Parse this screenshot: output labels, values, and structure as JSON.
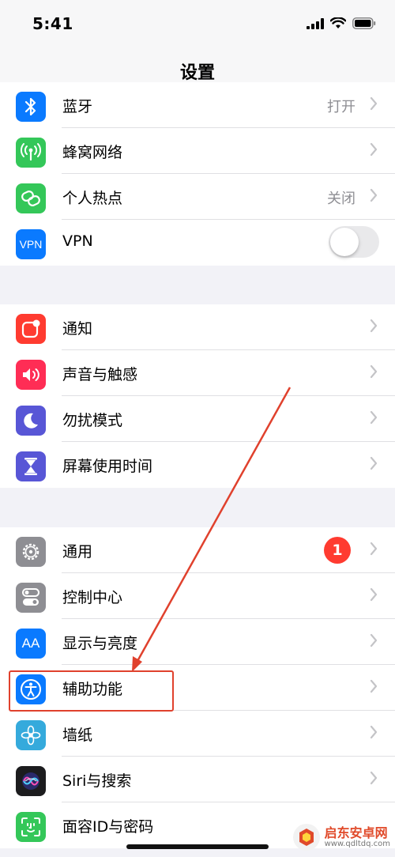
{
  "status": {
    "time": "5:41"
  },
  "nav": {
    "title": "设置"
  },
  "group1": [
    {
      "label": "蓝牙",
      "value": "打开",
      "icon": "bluetooth-icon",
      "color": "#0a7aff"
    },
    {
      "label": "蜂窝网络",
      "icon": "cellular-icon",
      "color": "#34c759"
    },
    {
      "label": "个人热点",
      "value": "关闭",
      "icon": "hotspot-icon",
      "color": "#34c759"
    },
    {
      "label": "VPN",
      "icon_text": "VPN",
      "icon": "vpn-icon",
      "color": "#0a7aff",
      "toggle": false
    }
  ],
  "group2": [
    {
      "label": "通知",
      "icon": "notifications-icon",
      "color": "#ff3b30"
    },
    {
      "label": "声音与触感",
      "icon": "sound-icon",
      "color": "#ff2d55"
    },
    {
      "label": "勿扰模式",
      "icon": "moon-icon",
      "color": "#5856d6"
    },
    {
      "label": "屏幕使用时间",
      "icon": "hourglass-icon",
      "color": "#5856d6"
    }
  ],
  "group3": [
    {
      "label": "通用",
      "icon": "gear-icon",
      "color": "#8e8e93",
      "badge": "1"
    },
    {
      "label": "控制中心",
      "icon": "control-center-icon",
      "color": "#8e8e93"
    },
    {
      "label": "显示与亮度",
      "icon_text": "AA",
      "icon": "display-icon",
      "color": "#0a7aff"
    },
    {
      "label": "辅助功能",
      "icon": "accessibility-icon",
      "color": "#0a7aff"
    },
    {
      "label": "墙纸",
      "icon": "wallpaper-icon",
      "color": "#35aadc"
    },
    {
      "label": "Siri与搜索",
      "icon": "siri-icon",
      "color": "#1c1c1e"
    },
    {
      "label": "面容ID与密码",
      "icon": "faceid-icon",
      "color": "#34c759"
    }
  ],
  "watermark": {
    "name": "启东安卓网",
    "url": "www.qdltdq.com"
  },
  "colors": {
    "annotation": "#e0412d",
    "badge": "#ff3b30"
  }
}
